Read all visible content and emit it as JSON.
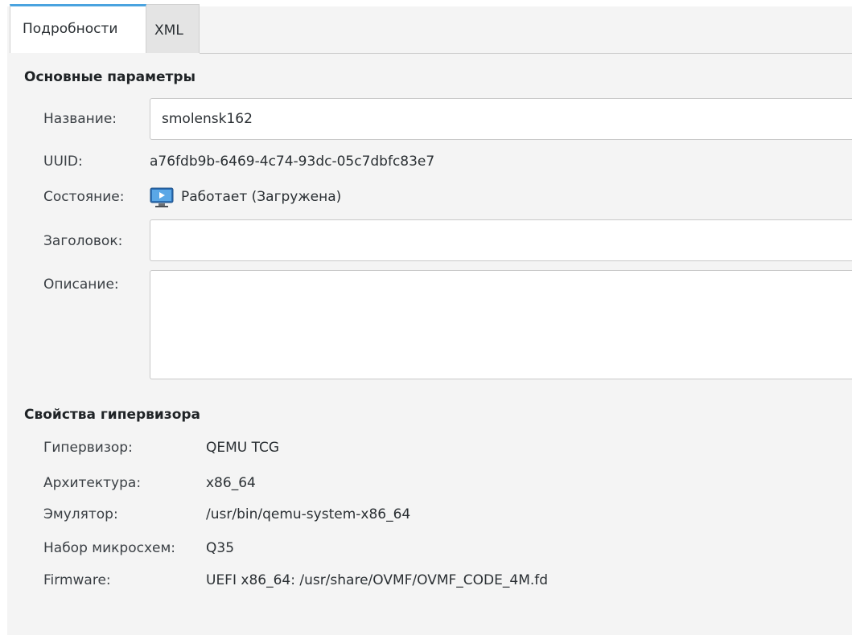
{
  "tabs": [
    {
      "label": "Подробности",
      "active": true
    },
    {
      "label": "XML",
      "active": false
    }
  ],
  "basic": {
    "title": "Основные параметры",
    "name_label": "Название:",
    "name_value": "smolensk162",
    "uuid_label": "UUID:",
    "uuid_value": "a76fdb9b-6469-4c74-93dc-05c7dbfc83e7",
    "state_label": "Состояние:",
    "state_icon": "vm-running-icon",
    "state_value": "Работает (Загружена)",
    "heading_label": "Заголовок:",
    "heading_value": "",
    "description_label": "Описание:",
    "description_value": ""
  },
  "hypervisor": {
    "title": "Свойства гипервизора",
    "rows": [
      {
        "label": "Гипервизор:",
        "value": "QEMU TCG"
      },
      {
        "label": "Архитектура:",
        "value": "x86_64"
      },
      {
        "label": "Эмулятор:",
        "value": "/usr/bin/qemu-system-x86_64"
      },
      {
        "label": "Набор микросхем:",
        "value": "Q35"
      },
      {
        "label": "Firmware:",
        "value": "UEFI x86_64: /usr/share/OVMF/OVMF_CODE_4M.fd"
      }
    ]
  },
  "colors": {
    "accent": "#4aa3df",
    "panel_bg": "#f4f4f4"
  }
}
